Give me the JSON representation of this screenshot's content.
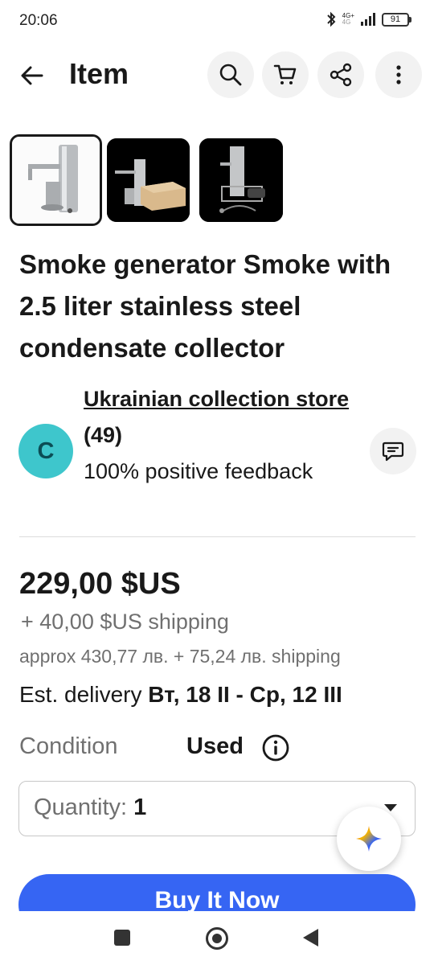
{
  "status_bar": {
    "time": "20:06",
    "network": "4G+",
    "network_sub": "4G",
    "battery": "91",
    "icons": [
      "bluetooth-icon",
      "signal-icon",
      "battery-icon"
    ]
  },
  "header": {
    "title": "Item",
    "icons": [
      "back-arrow-icon",
      "search-icon",
      "cart-icon",
      "share-icon",
      "more-vertical-icon"
    ]
  },
  "gallery": {
    "thumbnails": [
      {
        "selected": true,
        "background": "#ffffff"
      },
      {
        "selected": false,
        "background": "#000000"
      },
      {
        "selected": false,
        "background": "#000000"
      }
    ]
  },
  "item": {
    "title": "Smoke generator Smoke with 2.5 liter stainless steel condensate collector"
  },
  "seller": {
    "avatar_letter": "C",
    "name": "Ukrainian collection store",
    "count": "(49)",
    "feedback": "100% positive feedback",
    "message_icon": "message-icon"
  },
  "pricing": {
    "price": "229,00 $US",
    "shipping": "+ 40,00 $US shipping",
    "approx": "approx 430,77 лв. + 75,24 лв. shipping",
    "delivery_label": "Est. delivery",
    "delivery_dates": "Вт, 18 II - Ср, 12 III"
  },
  "condition": {
    "label": "Condition",
    "value": "Used"
  },
  "quantity": {
    "label": "Quantity:",
    "value": "1"
  },
  "actions": {
    "buy_now": "Buy It Now"
  },
  "colors": {
    "primary": "#3665f3",
    "avatar": "#3ec6cc",
    "text": "#191919",
    "secondary_text": "#707070"
  }
}
